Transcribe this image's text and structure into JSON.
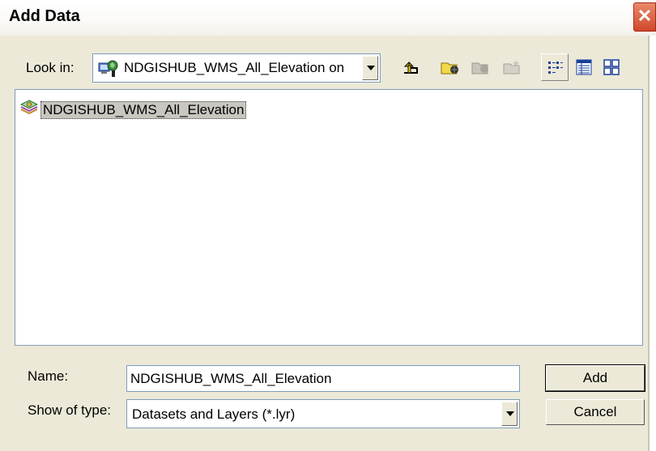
{
  "window": {
    "title": "Add Data",
    "close_glyph": "✕"
  },
  "toolbar": {
    "look_in_label": "Look in:",
    "look_in_value": "NDGISHUB_WMS_All_Elevation on",
    "buttons": [
      {
        "name": "up-one-level-icon"
      },
      {
        "name": "connect-to-folder-icon"
      },
      {
        "name": "disconnect-folder-icon"
      },
      {
        "name": "new-folder-icon"
      },
      {
        "name": "list-view-icon"
      },
      {
        "name": "details-view-icon"
      },
      {
        "name": "thumbnails-view-icon"
      }
    ]
  },
  "file_list": {
    "items": [
      {
        "label": "NDGISHUB_WMS_All_Elevation",
        "icon": "wms-layer-icon"
      }
    ]
  },
  "form": {
    "name_label": "Name:",
    "name_value": "NDGISHUB_WMS_All_Elevation",
    "type_label": "Show of type:",
    "type_value": "Datasets and Layers (*.lyr)",
    "add_label": "Add",
    "cancel_label": "Cancel"
  }
}
